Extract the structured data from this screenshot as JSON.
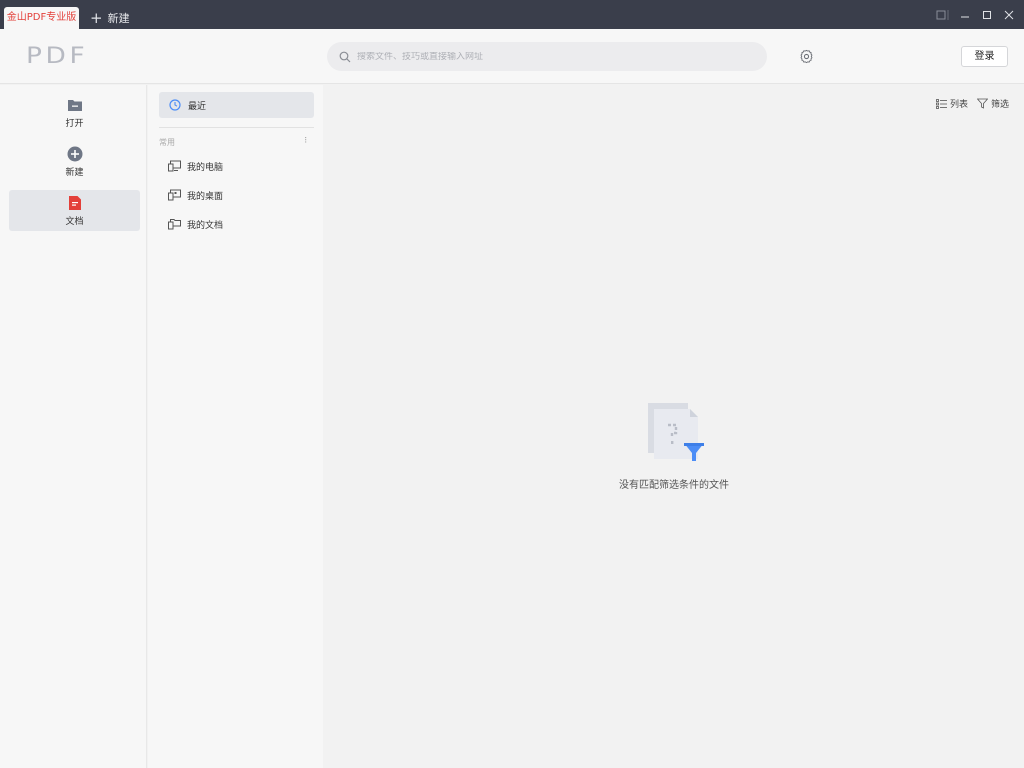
{
  "titlebar": {
    "active_tab": "金山PDF专业版",
    "new_tab_label": "新建"
  },
  "header": {
    "logo": "PDF",
    "search_placeholder": "搜索文件、技巧或直接输入网址",
    "login_label": "登录"
  },
  "leftnav": {
    "items": [
      {
        "label": "打开",
        "icon": "folder-icon"
      },
      {
        "label": "新建",
        "icon": "plus-circle-icon"
      },
      {
        "label": "文档",
        "icon": "document-icon"
      }
    ]
  },
  "midpanel": {
    "recent_label": "最近",
    "section_title": "常用",
    "locations": [
      {
        "label": "我的电脑",
        "icon": "computer-icon"
      },
      {
        "label": "我的桌面",
        "icon": "desktop-icon"
      },
      {
        "label": "我的文档",
        "icon": "folder-docs-icon"
      }
    ]
  },
  "main": {
    "list_label": "列表",
    "filter_label": "筛选",
    "empty_message": "没有匹配筛选条件的文件"
  },
  "colors": {
    "accent_red": "#e3403a",
    "accent_blue": "#4c8df6",
    "titlebar_bg": "#3a3e4b"
  }
}
